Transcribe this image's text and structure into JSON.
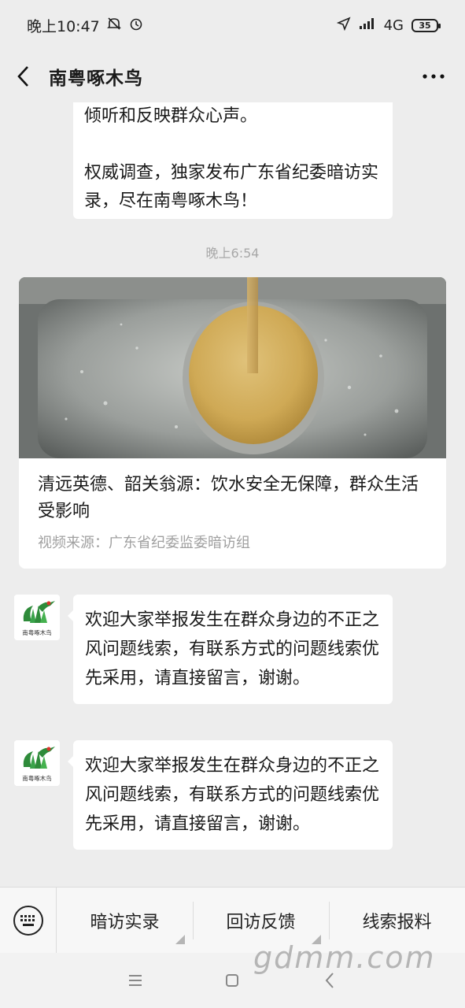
{
  "status_bar": {
    "time": "晚上10:47",
    "network": "4G",
    "battery": "35"
  },
  "header": {
    "title": "南粤啄木鸟"
  },
  "messages": {
    "top_bubble": {
      "line1": "倾听和反映群众心声。",
      "line2": "权威调查，独家发布广东省纪委暗访实录，尽在南粤啄木鸟！"
    },
    "time_stamp": "晚上6:54",
    "article": {
      "title": "清远英德、韶关翁源：饮水安全无保障，群众生活受影响",
      "source": "视频来源：广东省纪委监委暗访组"
    },
    "bubble_1": "欢迎大家举报发生在群众身边的不正之风问题线索，有联系方式的问题线索优先采用，请直接留言，谢谢。",
    "bubble_2": "欢迎大家举报发生在群众身边的不正之风问题线索，有联系方式的问题线索优先采用，请直接留言，谢谢。",
    "avatar_label": "南粤啄木鸟"
  },
  "menu": {
    "items": [
      "暗访实录",
      "回访反馈",
      "线索报料"
    ]
  },
  "watermark": "gdmm.com",
  "colors": {
    "background": "#ededed",
    "bubble": "#ffffff",
    "logo_green": "#2e8b3a",
    "logo_red": "#d9342b"
  }
}
